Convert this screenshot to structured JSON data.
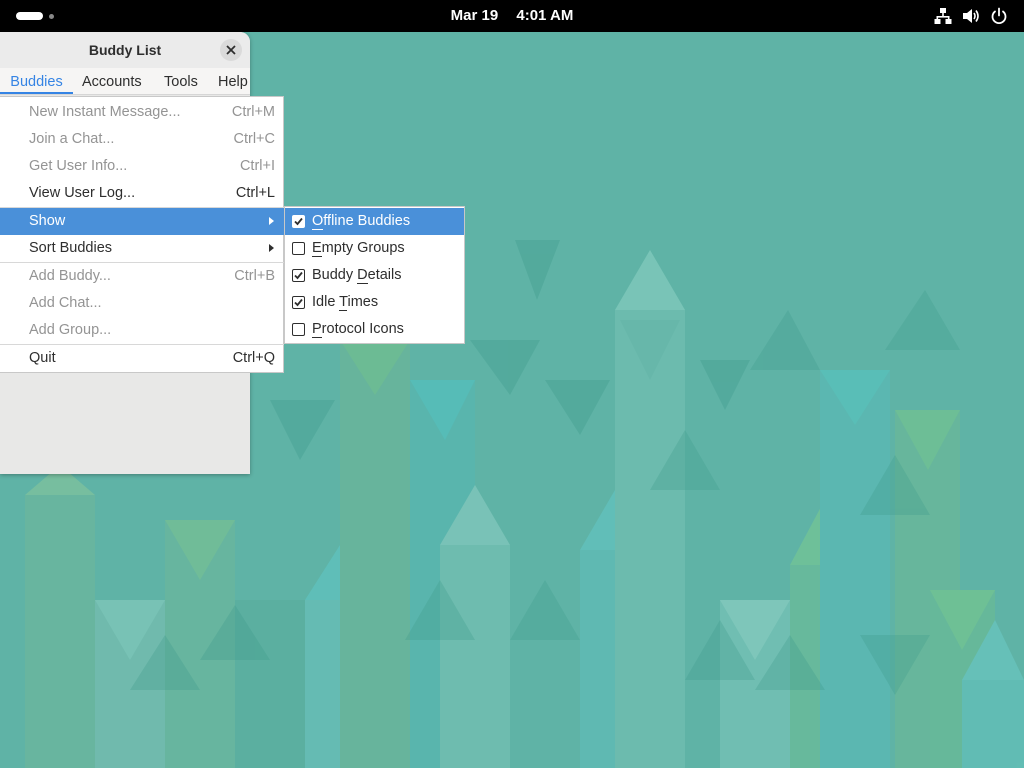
{
  "topbar": {
    "date": "Mar 19",
    "time": "4:01 AM",
    "icons": [
      "activities-indicator",
      "network-icon",
      "volume-icon",
      "power-icon"
    ]
  },
  "window": {
    "title": "Buddy List",
    "menubar": [
      {
        "label": "Buddies",
        "active": true
      },
      {
        "label": "Accounts"
      },
      {
        "label": "Tools"
      },
      {
        "label": "Help"
      }
    ]
  },
  "menu": {
    "items": [
      {
        "label": "New Instant Message...",
        "accel": "Ctrl+M",
        "enabled": false
      },
      {
        "label": "Join a Chat...",
        "accel": "Ctrl+C",
        "enabled": false
      },
      {
        "label": "Get User Info...",
        "accel": "Ctrl+I",
        "enabled": false
      },
      {
        "label": "View User Log...",
        "accel": "Ctrl+L",
        "enabled": true
      },
      {
        "label": "Show",
        "submenu": true,
        "active": true
      },
      {
        "label": "Sort Buddies",
        "submenu": true
      },
      {
        "label": "Add Buddy...",
        "accel": "Ctrl+B",
        "enabled": false
      },
      {
        "label": "Add Chat...",
        "enabled": false
      },
      {
        "label": "Add Group...",
        "enabled": false
      },
      {
        "label": "Quit",
        "accel": "Ctrl+Q",
        "enabled": true
      }
    ]
  },
  "submenu": {
    "items": [
      {
        "mnemonic": "O",
        "rest": "ffline Buddies",
        "pre": "",
        "checked": true,
        "active": true
      },
      {
        "mnemonic": "E",
        "rest": "mpty Groups",
        "pre": "",
        "checked": false
      },
      {
        "pre": "Buddy ",
        "mnemonic": "D",
        "rest": "etails",
        "checked": true
      },
      {
        "pre": "Idle ",
        "mnemonic": "T",
        "rest": "imes",
        "checked": true
      },
      {
        "pre": "",
        "mnemonic": "P",
        "rest": "rotocol Icons",
        "checked": false
      }
    ]
  },
  "colors": {
    "desktop_bg": "#5fb3a6",
    "menu_highlight": "#4a90d9",
    "accent": "#3584e4"
  }
}
